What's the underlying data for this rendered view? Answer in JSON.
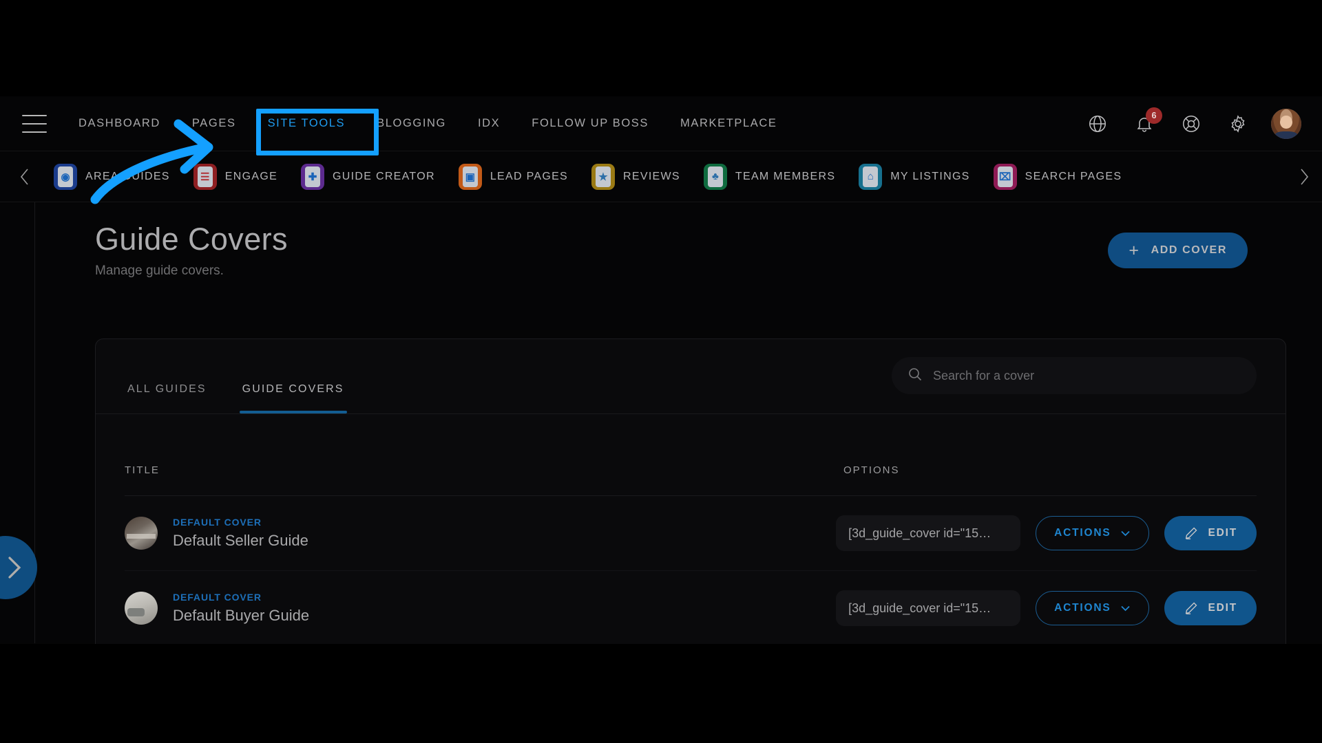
{
  "topnav": {
    "menu_icon": "hamburger-icon",
    "items": [
      {
        "label": "DASHBOARD",
        "active": false
      },
      {
        "label": "PAGES",
        "active": false
      },
      {
        "label": "SITE TOOLS",
        "active": true
      },
      {
        "label": "BLOGGING",
        "active": false
      },
      {
        "label": "IDX",
        "active": false
      },
      {
        "label": "FOLLOW UP BOSS",
        "active": false
      },
      {
        "label": "MARKETPLACE",
        "active": false
      }
    ],
    "right_icons": [
      {
        "name": "globe-icon"
      },
      {
        "name": "notification-bell-icon",
        "badge": "6"
      },
      {
        "name": "help-lifebuoy-icon"
      },
      {
        "name": "settings-gear-icon"
      },
      {
        "name": "user-avatar"
      }
    ]
  },
  "annotation": {
    "highlight_target": "SITE TOOLS",
    "highlight_color": "#14a0ff",
    "arrow_color": "#14a0ff"
  },
  "subnav": {
    "prev_label": "‹",
    "next_label": "›",
    "tools": [
      {
        "label": "AREA GUIDES",
        "icon": "area-guides-icon",
        "color": "#1b3c8c",
        "glyph": "◉"
      },
      {
        "label": "ENGAGE",
        "icon": "engage-icon",
        "color": "#8e1f22",
        "glyph": "≡"
      },
      {
        "label": "GUIDE CREATOR",
        "icon": "guide-creator-icon",
        "color": "#5c2a8e",
        "glyph": "✚"
      },
      {
        "label": "LEAD PAGES",
        "icon": "lead-pages-icon",
        "color": "#c25a18",
        "glyph": "▣"
      },
      {
        "label": "REVIEWS",
        "icon": "reviews-icon",
        "color": "#9a7a14",
        "glyph": "★"
      },
      {
        "label": "TEAM MEMBERS",
        "icon": "team-members-icon",
        "color": "#0f6b3f",
        "glyph": "♣"
      },
      {
        "label": "MY LISTINGS",
        "icon": "my-listings-icon",
        "color": "#17708e",
        "glyph": "⌂"
      },
      {
        "label": "SEARCH PAGES",
        "icon": "search-pages-icon",
        "color": "#8e1b55",
        "glyph": "⌕"
      }
    ]
  },
  "page": {
    "title": "Guide Covers",
    "subtitle": "Manage guide covers.",
    "add_button": "ADD COVER",
    "add_button_icon": "plus-icon"
  },
  "card": {
    "tabs": [
      {
        "label": "ALL GUIDES",
        "active": false
      },
      {
        "label": "GUIDE COVERS",
        "active": true
      }
    ],
    "search": {
      "placeholder": "Search for a cover",
      "value": "",
      "icon": "search-icon"
    },
    "columns": {
      "title": "TITLE",
      "options": "OPTIONS"
    },
    "rows": [
      {
        "kicker": "DEFAULT COVER",
        "name": "Default Seller Guide",
        "thumb": "kitchen",
        "shortcode": "[3d_guide_cover id=\"15…",
        "actions_label": "ACTIONS",
        "actions_icon": "chevron-down-icon",
        "edit_label": "EDIT",
        "edit_icon": "pencil-icon"
      },
      {
        "kicker": "DEFAULT COVER",
        "name": "Default Buyer Guide",
        "thumb": "living",
        "shortcode": "[3d_guide_cover id=\"15…",
        "actions_label": "ACTIONS",
        "actions_icon": "chevron-down-icon",
        "edit_label": "EDIT",
        "edit_icon": "pencil-icon"
      }
    ]
  },
  "side_toggle": {
    "icon": "chevron-right-icon",
    "color": "#0f4d80"
  },
  "colors": {
    "background": "#050506",
    "accent_blue": "#1f9cf0",
    "button_blue": "#10558c",
    "link_blue": "#1d6fb8",
    "badge_red": "#9e2a2a",
    "text_primary": "#acacae",
    "text_muted": "#6e6e70"
  }
}
